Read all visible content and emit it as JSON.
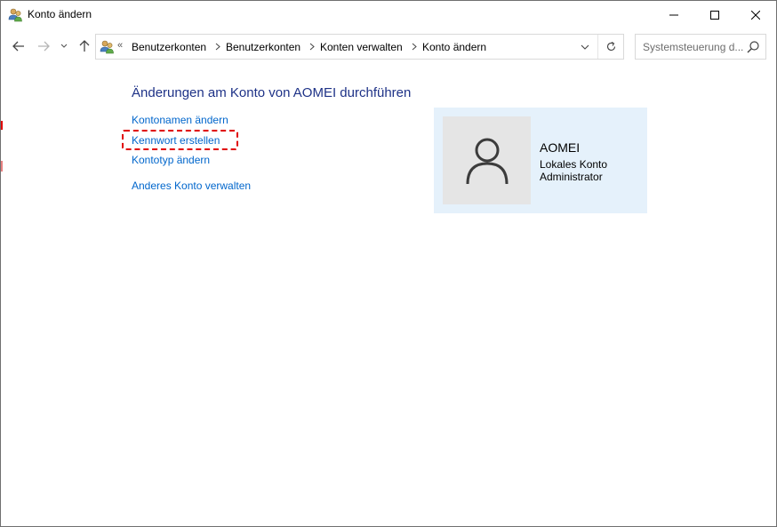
{
  "window": {
    "title": "Konto ändern",
    "buttons": {
      "minimize": "minimize",
      "maximize": "maximize",
      "close": "close"
    }
  },
  "nav": {
    "back_icon": "back-arrow-icon",
    "forward_icon": "forward-arrow-icon",
    "recent_icon": "chevron-down-icon",
    "up_icon": "up-arrow-icon"
  },
  "address": {
    "overflow": "«",
    "breadcrumbs": [
      "Benutzerkonten",
      "Benutzerkonten",
      "Konten verwalten",
      "Konto ändern"
    ]
  },
  "search": {
    "placeholder": "Systemsteuerung d..."
  },
  "main": {
    "heading": "Änderungen am Konto von AOMEI durchführen",
    "links": [
      "Kontonamen ändern",
      "Kennwort erstellen",
      "Kontotyp ändern"
    ],
    "other_link": "Anderes Konto verwalten"
  },
  "account": {
    "name": "AOMEI",
    "type": "Lokales Konto",
    "role": "Administrator"
  },
  "colors": {
    "heading": "#1e3287",
    "link": "#0066cc",
    "card_bg": "#e5f1fb",
    "highlight": "#e00000"
  }
}
